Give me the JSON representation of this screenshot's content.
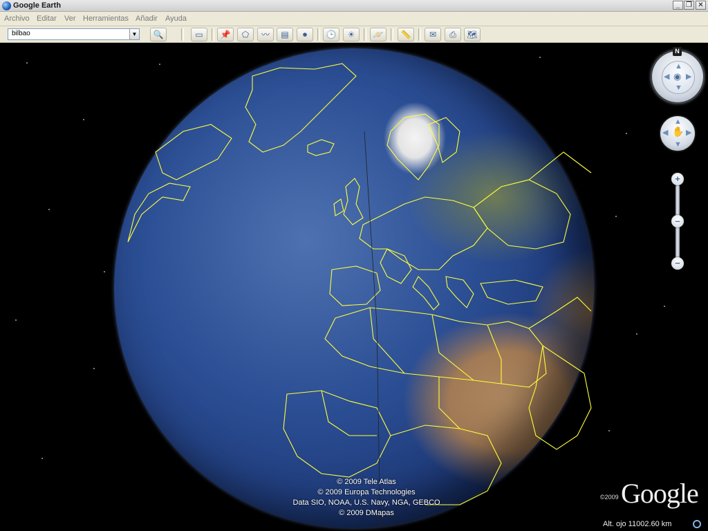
{
  "window": {
    "title": "Google Earth"
  },
  "window_controls": {
    "minimize": "_",
    "restore": "❐",
    "close": "✕"
  },
  "menu": [
    "Archivo",
    "Editar",
    "Ver",
    "Herramientas",
    "Añadir",
    "Ayuda"
  ],
  "search": {
    "value": "bilbao",
    "dropdown_glyph": "▼",
    "button_glyph": "🔍"
  },
  "toolbar": {
    "buttons": [
      {
        "icon": "sidebar-toggle-icon",
        "glyph": "▭"
      },
      {
        "icon": "placemark-icon",
        "glyph": "📌"
      },
      {
        "icon": "polygon-icon",
        "glyph": "⬠"
      },
      {
        "icon": "path-icon",
        "glyph": "〰"
      },
      {
        "icon": "image-overlay-icon",
        "glyph": "▤"
      },
      {
        "icon": "record-tour-icon",
        "glyph": "⏺"
      },
      {
        "icon": "historical-imagery-icon",
        "glyph": "🕒"
      },
      {
        "icon": "sunlight-icon",
        "glyph": "☀"
      },
      {
        "icon": "planets-icon",
        "glyph": "🪐"
      },
      {
        "icon": "ruler-icon",
        "glyph": "📏"
      },
      {
        "icon": "email-icon",
        "glyph": "✉"
      },
      {
        "icon": "print-icon",
        "glyph": "⎙"
      },
      {
        "icon": "view-in-maps-icon",
        "glyph": "🗺"
      }
    ]
  },
  "view": {
    "credits": [
      "© 2009 Tele Atlas",
      "© 2009 Europa Technologies",
      "Data SIO, NOAA, U.S. Navy, NGA, GEBCO",
      "© 2009 DMapas"
    ],
    "logo_year": "©2009",
    "logo_text": "Google",
    "altitude": "Alt. ojo 11002.60 km"
  },
  "navigation": {
    "compass_label": "N",
    "zoom_in_label": "+",
    "zoom_out_label": "−",
    "zoom_slider_level": 0.5
  },
  "colors": {
    "border_lines": "#ffff3a",
    "ocean": "#2c4f95",
    "space": "#000000"
  }
}
